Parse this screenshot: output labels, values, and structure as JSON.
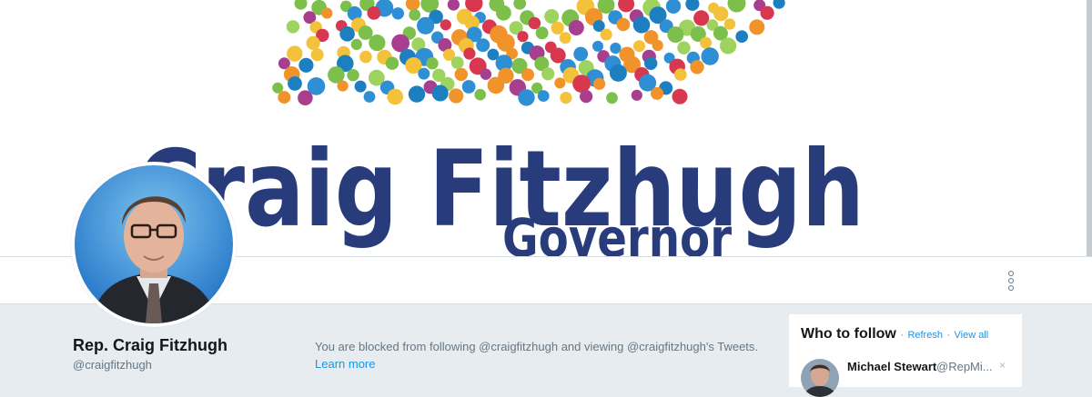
{
  "banner": {
    "title_line1": "Craig Fitzhugh",
    "title_line2": "Governor",
    "dot_colors": [
      "#2f8fd4",
      "#d8384f",
      "#f3c13a",
      "#7cc04b",
      "#f0932b",
      "#1d7fc0",
      "#a83e8e",
      "#9fd35f"
    ]
  },
  "profile": {
    "name": "Rep. Craig Fitzhugh",
    "handle": "@craigfitzhugh",
    "avatar_icon": "profile-photo"
  },
  "nav": {
    "more_icon": "more-vertical-icon"
  },
  "blocked": {
    "message": "You are blocked from following @craigfitzhugh and viewing @craigfitzhugh's Tweets.",
    "learn_more": "Learn more"
  },
  "who_to_follow": {
    "title": "Who to follow",
    "dot": "·",
    "refresh": "Refresh",
    "view_all": "View all",
    "user": {
      "name": "Michael Stewart",
      "handle": "@RepMi...",
      "dismiss": "×"
    }
  },
  "colors": {
    "banner_text": "#283c7c",
    "link": "#1b95e0",
    "page_background": "#e6ecf0"
  }
}
